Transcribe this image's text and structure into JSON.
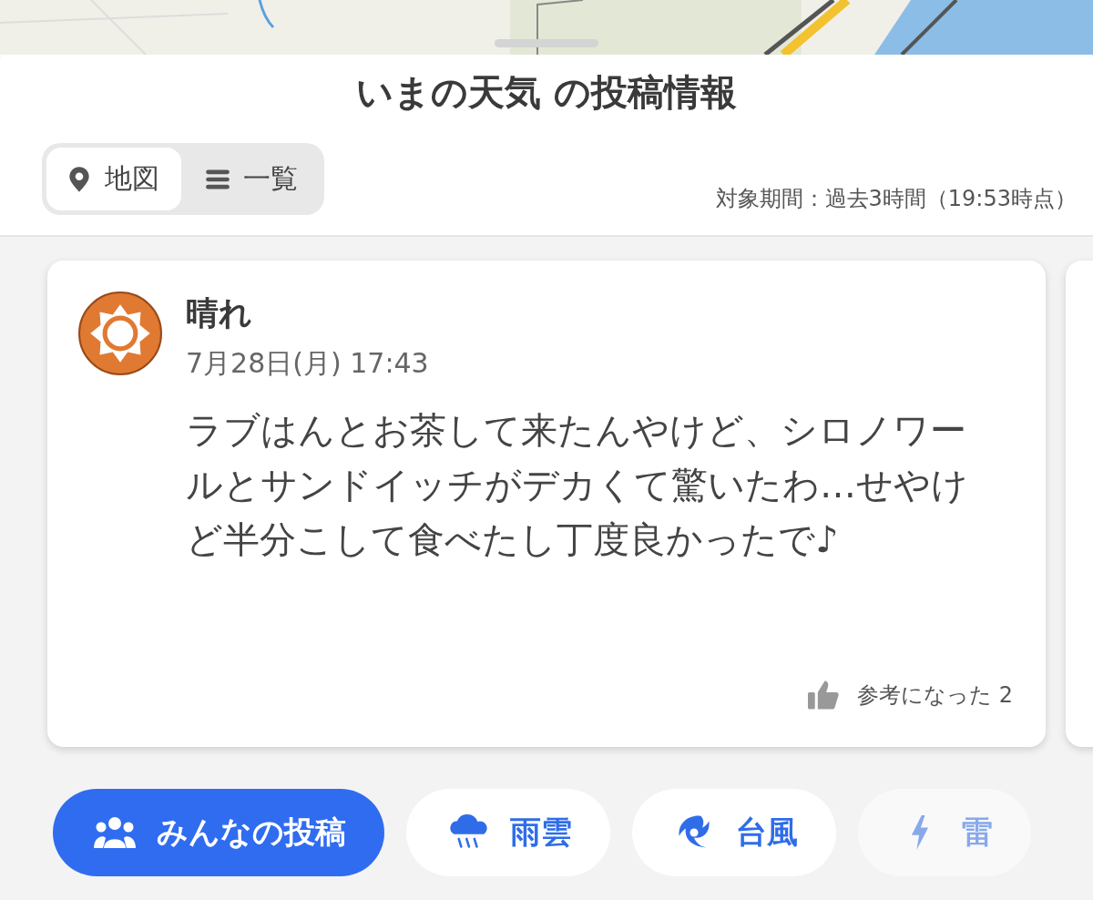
{
  "sheet": {
    "title": "いまの天気 の投稿情報"
  },
  "view_toggle": [
    {
      "label": "地図",
      "kind": "map",
      "selected": true
    },
    {
      "label": "一覧",
      "kind": "list",
      "selected": false
    }
  ],
  "period": "対象期間：過去3時間（19:53時点）",
  "post": {
    "weather": "晴れ",
    "color": "#e07a32",
    "date": "7月28日(月) 17:43",
    "text": "ラブはんとお茶して来たんやけど、シロノワールとサンドイッチがデカくて驚いたわ…せやけど半分こして食べたし丁度良かったで♪",
    "helpful_label": "参考になった 2"
  },
  "chips": [
    {
      "label": "みんなの投稿",
      "kind": "people",
      "selected": true
    },
    {
      "label": "雨雲",
      "kind": "rain",
      "selected": false
    },
    {
      "label": "台風",
      "kind": "typhoon",
      "selected": false
    },
    {
      "label": "雷",
      "kind": "thunder",
      "selected": false
    }
  ]
}
